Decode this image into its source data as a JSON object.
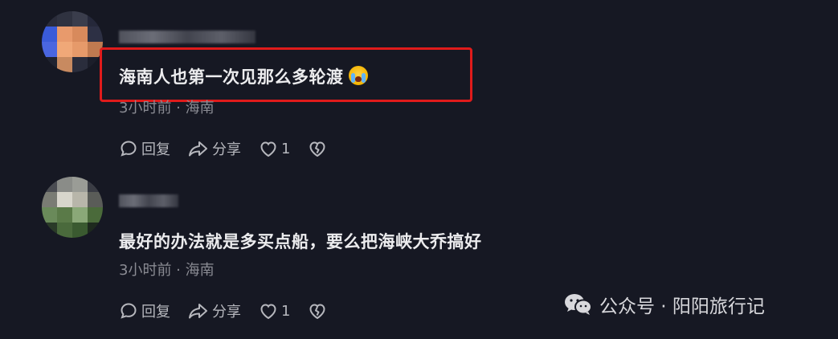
{
  "comments": [
    {
      "text": "海南人也第一次见那么多轮渡",
      "emoji": "crying-face-emoji",
      "time_location": "3小时前 · 海南",
      "reply_label": "回复",
      "share_label": "分享",
      "like_count": "1",
      "highlighted": true,
      "highlight_color": "#e01b1b"
    },
    {
      "text": "最好的办法就是多买点船，要么把海峡大乔搞好",
      "time_location": "3小时前 · 海南",
      "reply_label": "回复",
      "share_label": "分享",
      "like_count": "1",
      "highlighted": false
    }
  ],
  "watermark": {
    "text": "公众号 · 阳阳旅行记",
    "icon": "wechat-icon"
  },
  "colors": {
    "background": "#161823",
    "highlight": "#e01b1b",
    "text_primary": "#ececee",
    "text_meta": "#8a8b93"
  }
}
